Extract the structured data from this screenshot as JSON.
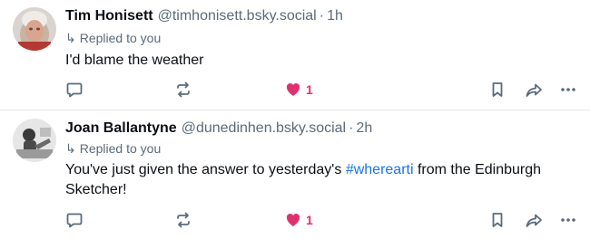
{
  "posts": [
    {
      "author_name": "Tim Honisett",
      "handle": "@timhonisett.bsky.social",
      "separator": "·",
      "time": "1h",
      "replied_label": "Replied to you",
      "text": "I'd blame the weather",
      "like_count": "1",
      "liked": true
    },
    {
      "author_name": "Joan Ballantyne",
      "handle": "@dunedinhen.bsky.social",
      "separator": "·",
      "time": "2h",
      "replied_label": "Replied to you",
      "text_before": "You've just given the answer to yesterday's ",
      "hashtag": "#wherearti",
      "text_after": " from the Edinburgh Sketcher!",
      "like_count": "1",
      "liked": true
    }
  ],
  "icons": {
    "reply": "speech-bubble-icon",
    "repost": "repost-arrows-icon",
    "like": "heart-icon",
    "bookmark": "bookmark-icon",
    "share": "share-arrow-icon",
    "more": "ellipsis-icon",
    "replied": "reply-arrow-icon"
  },
  "colors": {
    "text": "#0b0f14",
    "muted": "#5b6b7b",
    "like": "#e0316f",
    "hashtag": "#1a73e8",
    "divider": "#e3e7eb"
  }
}
